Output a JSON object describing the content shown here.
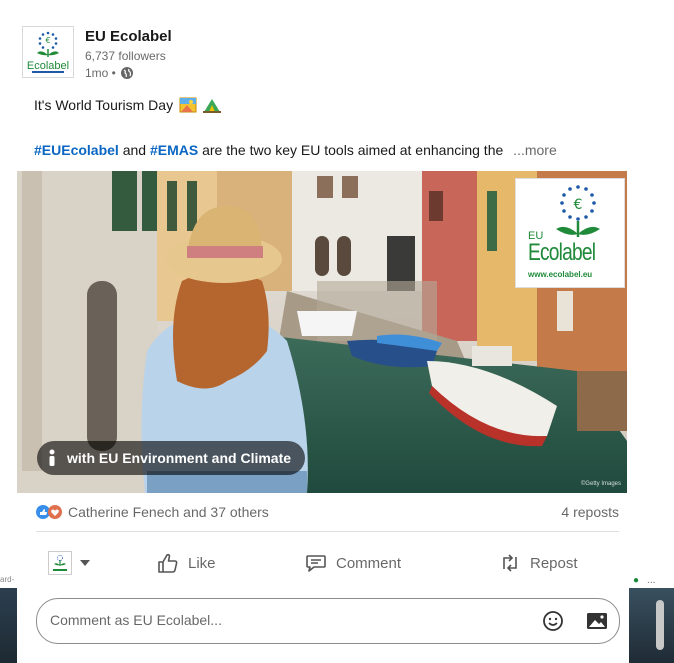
{
  "post": {
    "author": "EU Ecolabel",
    "followers": "6,737 followers",
    "time": "1mo •",
    "line1": "It's World Tourism Day",
    "tag1": "#EUEcolabel",
    "and_text": "and",
    "tag2": "#EMAS",
    "line2_rest": "are the two key EU tools aimed at enhancing the",
    "more": "...more",
    "image_tag": "with EU Environment and Climate",
    "badge_eu": "EU",
    "badge_brand": "Ecolabel",
    "badge_url": "www.ecolabel.eu",
    "credit": "©Getty Images"
  },
  "social": {
    "reactions_text": "Catherine Fenech and 37 others",
    "reposts": "4 reposts"
  },
  "actions": {
    "like": "Like",
    "comment": "Comment",
    "repost": "Repost"
  },
  "comment": {
    "placeholder": "Comment as EU Ecolabel..."
  },
  "background": {
    "left_fragment": "ard-",
    "right_ellipsis": "..."
  },
  "colors": {
    "link": "#0a66c2",
    "ecolabel_green": "#1f8a3a",
    "ecolabel_blue": "#1e5aa8"
  }
}
